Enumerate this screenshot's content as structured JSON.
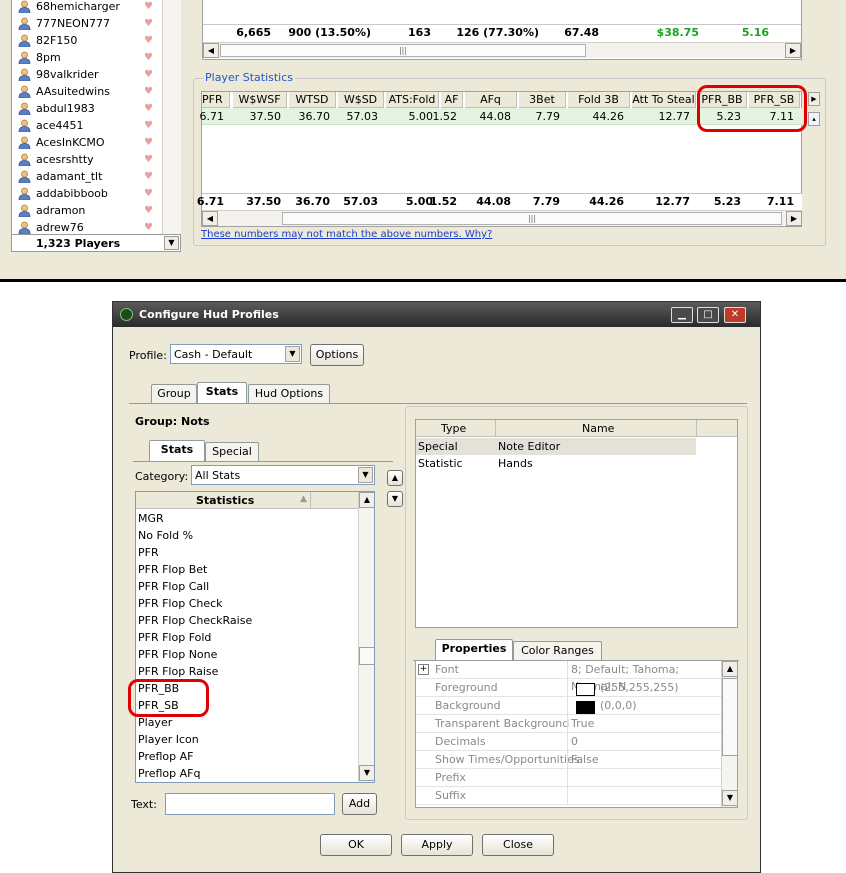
{
  "players": {
    "items": [
      "68hemicharger",
      "777NEON777",
      "82F150",
      "8pm",
      "98valkrider",
      "AAsuitedwins",
      "abdul1983",
      "ace4451",
      "AcesInKCMO",
      "acesrshtty",
      "adamant_tlt",
      "addabibboob",
      "adramon",
      "adrew76"
    ],
    "count": "1,323 Players"
  },
  "session_totals": [
    "6,665",
    "900 (13.50%)",
    "163",
    "126 (77.30%)",
    "67.48",
    "$38.75",
    "5.16"
  ],
  "player_stats": {
    "title": "Player Statistics",
    "columns": [
      "PFR",
      "W$WSF",
      "WTSD",
      "W$SD",
      "ATS:Fold",
      "AF",
      "AFq",
      "3Bet",
      "Fold 3B",
      "Att To Steal",
      "PFR_BB",
      "PFR_SB"
    ],
    "row": [
      "6.71",
      "37.50",
      "36.70",
      "57.03",
      "5.00",
      "1.52",
      "44.08",
      "7.79",
      "44.26",
      "12.77",
      "5.23",
      "7.11"
    ],
    "totals": [
      "6.71",
      "37.50",
      "36.70",
      "57.03",
      "5.00",
      "1.52",
      "44.08",
      "7.79",
      "44.26",
      "12.77",
      "5.23",
      "7.11"
    ],
    "note": "These numbers may not match the above numbers.  Why?"
  },
  "dialog": {
    "title": "Configure Hud Profiles",
    "profile_label": "Profile:",
    "profile_value": "Cash - Default",
    "options_label": "Options",
    "tabs": [
      "Group",
      "Stats",
      "Hud Options"
    ],
    "group_label": "Group:",
    "group_value": "Nots",
    "sub_tabs": [
      "Stats",
      "Special"
    ],
    "category_label": "Category:",
    "category_value": "All Stats",
    "statistics_header": "Statistics",
    "statistics": [
      "MGR",
      "No Fold %",
      "PFR",
      "PFR Flop Bet",
      "PFR Flop Call",
      "PFR Flop Check",
      "PFR Flop CheckRaise",
      "PFR Flop Fold",
      "PFR Flop None",
      "PFR Flop Raise",
      "PFR_BB",
      "PFR_SB",
      "Player",
      "Player Icon",
      "Preflop AF",
      "Preflop AFq"
    ],
    "text_label": "Text:",
    "add_label": "Add",
    "selected_headers": [
      "Type",
      "Name"
    ],
    "selected_rows": [
      {
        "type": "Special",
        "name": "Note Editor"
      },
      {
        "type": "Statistic",
        "name": "Hands"
      }
    ],
    "prop_tabs": [
      "Properties",
      "Color Ranges"
    ],
    "properties": [
      {
        "name": "Font",
        "value": "8; Default; Tahoma; Normal; N"
      },
      {
        "name": "Foreground",
        "value": "(255,255,255)"
      },
      {
        "name": "Background",
        "value": "(0,0,0)"
      },
      {
        "name": "Transparent Background",
        "value": "True"
      },
      {
        "name": "Decimals",
        "value": "0"
      },
      {
        "name": "Show Times/Opportunities",
        "value": "False"
      },
      {
        "name": "Prefix",
        "value": ""
      },
      {
        "name": "Suffix",
        "value": ""
      }
    ],
    "buttons": {
      "ok": "OK",
      "apply": "Apply",
      "close": "Close"
    }
  },
  "colors": {
    "highlight": "#e00000",
    "money_green": "#1aa31a",
    "link_blue": "#1a3bcc"
  }
}
